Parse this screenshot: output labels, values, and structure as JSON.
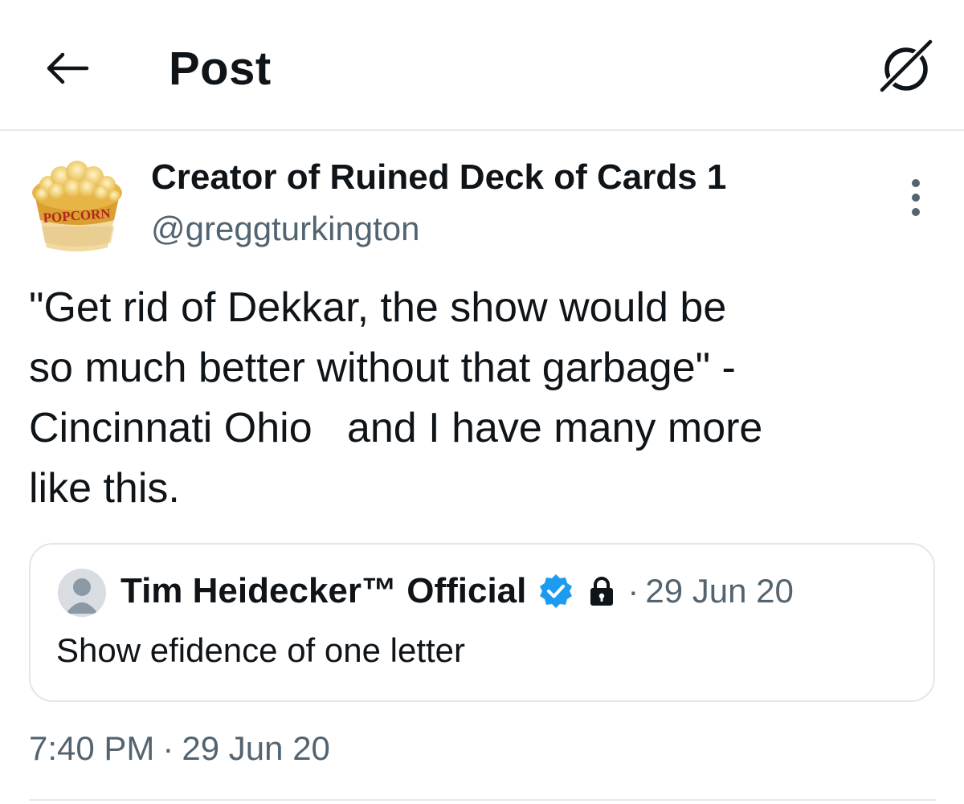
{
  "header": {
    "title": "Post",
    "back_icon": "arrow-left-icon",
    "grok_icon": "grok-icon"
  },
  "post": {
    "author": {
      "display_name": "Creator of Ruined Deck of Cards 1",
      "handle": "@greggturkington",
      "avatar": "popcorn-bucket-avatar",
      "avatar_text": "POPCORN"
    },
    "text": "\"Get rid of Dekkar, the show would be\nso much better without that garbage\" -\nCincinnati Ohio   and I have many more\nlike this.",
    "time": "7:40 PM",
    "separator": "·",
    "date": "29 Jun 20"
  },
  "quote": {
    "author": {
      "display_name": "Tim Heidecker™ Official",
      "avatar": "default-profile-avatar",
      "verified_icon": "verified-badge-icon",
      "protected_icon": "lock-icon"
    },
    "separator": "·",
    "date": "29 Jun 20",
    "text": "Show efidence of one letter"
  },
  "colors": {
    "text_primary": "#0f1419",
    "text_secondary": "#536471",
    "verified_blue": "#1d9bf0",
    "divider": "#e6e8ea"
  }
}
